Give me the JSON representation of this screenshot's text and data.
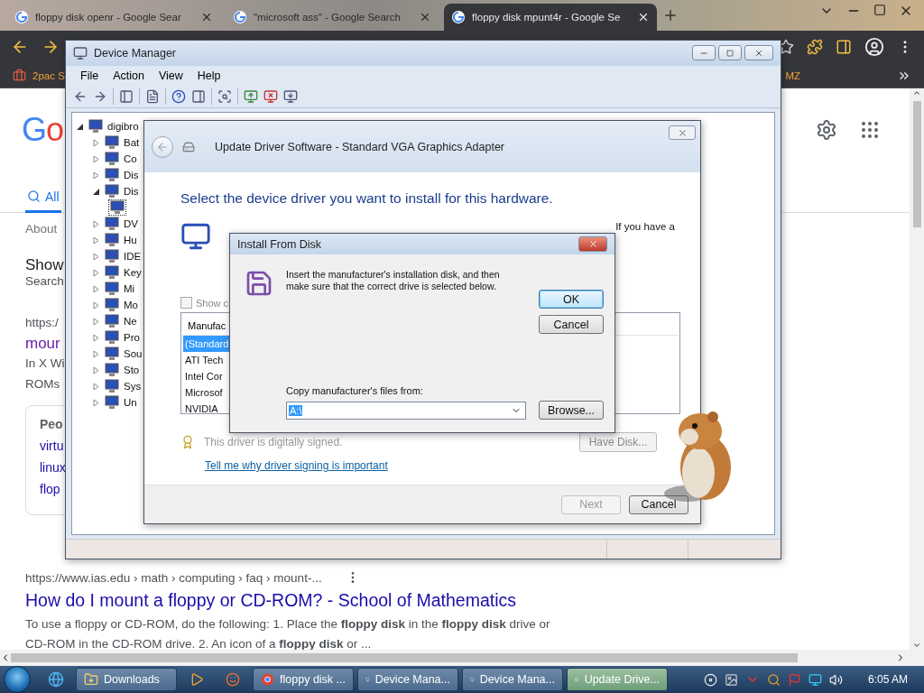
{
  "browser": {
    "tabs": [
      {
        "title": "floppy disk openr - Google Sear",
        "selected": false
      },
      {
        "title": "\"microsoft ass\" - Google Search",
        "selected": false
      },
      {
        "title": "floppy disk mpunt4r - Google Se",
        "selected": true
      }
    ],
    "bookmarks": [
      {
        "label": "2pac S"
      },
      {
        "label": "MZ"
      }
    ]
  },
  "search_page": {
    "logo": "Go",
    "nav_tabs": [
      {
        "label": "All",
        "selected": true
      }
    ],
    "about": "About",
    "heading": "Show",
    "subline": "Search",
    "result_1": {
      "url": "https:/",
      "title": "mour",
      "snippet_lines": [
        "In X Wi",
        "ROMs"
      ]
    },
    "people_also_ask": {
      "title": "Peo",
      "items": [
        "virtu",
        "linux",
        "flop"
      ]
    },
    "result_2": {
      "url": "https://www.ias.edu › math › computing › faq › mount-...",
      "title": "How do I mount a floppy or CD-ROM? - School of Mathematics",
      "snippet": "To use a floppy or CD-ROM, do the following: 1. Place the **floppy disk** in the **floppy disk** drive or CD-ROM in the CD-ROM drive. 2. An icon of a **floppy disk** or ..."
    }
  },
  "device_manager": {
    "title": "Device Manager",
    "menu": [
      "File",
      "Action",
      "View",
      "Help"
    ],
    "tree": {
      "label": "digibro",
      "expanded": true,
      "children": [
        {
          "label": "Bat",
          "expanded": false
        },
        {
          "label": "Co",
          "expanded": false
        },
        {
          "label": "Dis",
          "expanded": false
        },
        {
          "label": "Dis",
          "expanded": true,
          "children": [
            {
              "selected": true
            }
          ]
        },
        {
          "label": "DV",
          "expanded": false
        },
        {
          "label": "Hu",
          "expanded": false
        },
        {
          "label": "IDE",
          "expanded": false
        },
        {
          "label": "Key",
          "expanded": false
        },
        {
          "label": "Mi",
          "expanded": false
        },
        {
          "label": "Mo",
          "expanded": false
        },
        {
          "label": "Ne",
          "expanded": false
        },
        {
          "label": "Pro",
          "expanded": false
        },
        {
          "label": "Sou",
          "expanded": false
        },
        {
          "label": "Sto",
          "expanded": false
        },
        {
          "label": "Sys",
          "expanded": false
        },
        {
          "label": "Un",
          "expanded": false
        }
      ]
    }
  },
  "update_driver": {
    "title": "Update Driver Software - Standard VGA Graphics Adapter",
    "heading": "Select the device driver you want to install for this hardware.",
    "instructions": "If you have a",
    "show_compatible": {
      "label": "Show c",
      "checked": false
    },
    "manufacturer_header": "Manufac",
    "manufacturers": [
      {
        "label": "(Standard",
        "selected": true
      },
      {
        "label": "ATI Tech",
        "selected": false
      },
      {
        "label": "Intel Cor",
        "selected": false
      },
      {
        "label": "Microsof",
        "selected": false
      },
      {
        "label": "NVIDIA",
        "selected": false
      }
    ],
    "signed_note": "This driver is digitally signed.",
    "signing_link": "Tell me why driver signing is important",
    "have_disk": "Have Disk...",
    "buttons": [
      {
        "label": "Next",
        "disabled": true
      },
      {
        "label": "Cancel",
        "disabled": false
      }
    ]
  },
  "install_from_disk": {
    "title": "Install From Disk",
    "message": "Insert the manufacturer's installation disk, and then make sure that the correct drive is selected below.",
    "ok": "OK",
    "cancel": "Cancel",
    "copy_label": "Copy manufacturer's files from:",
    "path": "A:\\",
    "browse": "Browse..."
  },
  "taskbar": {
    "items": [
      {
        "kind": "ie"
      },
      {
        "kind": "folder",
        "label": "Downloads",
        "selected": false
      },
      {
        "kind": "media"
      },
      {
        "kind": "app"
      },
      {
        "kind": "browser",
        "label": "floppy disk ...",
        "selected": false
      },
      {
        "kind": "devmgr",
        "label": "Device Mana...",
        "selected": false
      },
      {
        "kind": "devmgr",
        "label": "Device Mana...",
        "selected": false
      },
      {
        "kind": "driver",
        "label": "Update Drive...",
        "selected": true
      }
    ],
    "clock": "6:05 AM"
  }
}
